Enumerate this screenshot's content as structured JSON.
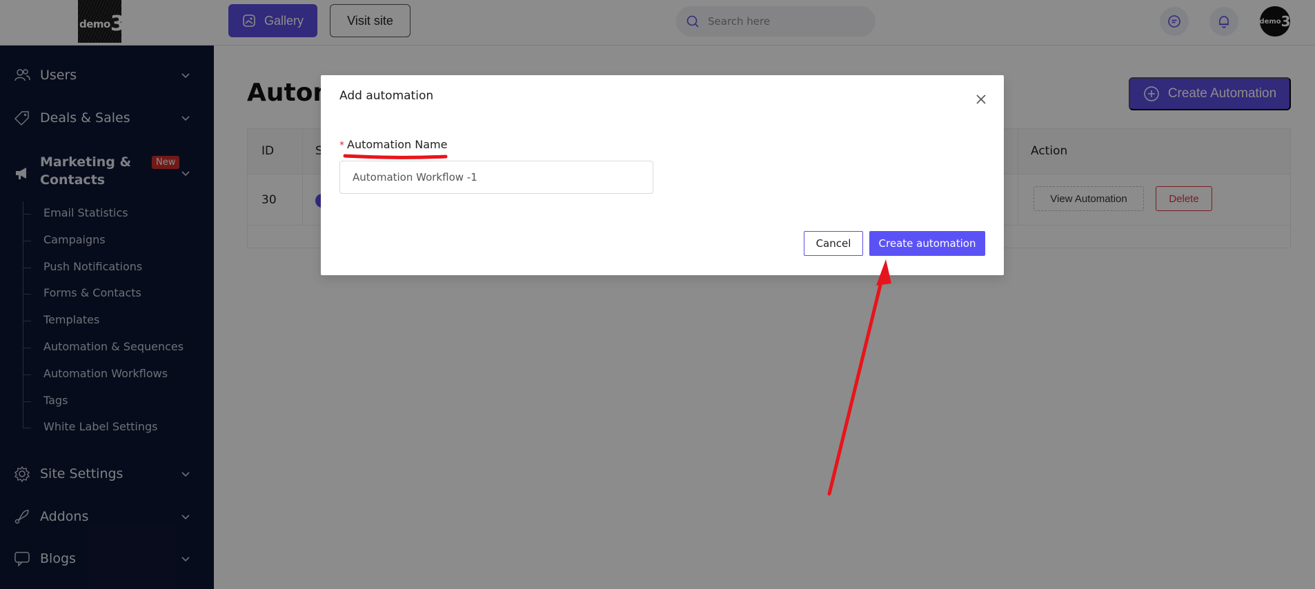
{
  "header": {
    "logo_text": "demo",
    "logo_number": "3",
    "gallery_label": "Gallery",
    "visit_site_label": "Visit site",
    "search_placeholder": "Search here",
    "chat_icon": "chat-icon",
    "bell_icon": "bell-icon"
  },
  "sidebar": {
    "items": [
      {
        "label": "Users",
        "icon": "users-icon"
      },
      {
        "label": "Deals & Sales",
        "icon": "tag-icon"
      },
      {
        "label": "Marketing &",
        "label2": "Contacts",
        "icon": "megaphone-icon",
        "badge": "New"
      },
      {
        "label": "Site Settings",
        "icon": "gear-icon"
      },
      {
        "label": "Addons",
        "icon": "rocket-icon"
      },
      {
        "label": "Blogs",
        "icon": "chat-bubble-icon"
      }
    ],
    "sub_items": [
      "Email Statistics",
      "Campaigns",
      "Push Notifications",
      "Forms & Contacts",
      "Templates",
      "Automation & Sequences",
      "Automation Workflows",
      "Tags",
      "White Label Settings"
    ]
  },
  "main": {
    "title": "Autom",
    "create_button": "Create Automation",
    "table": {
      "headers": [
        "ID",
        "S",
        "Action"
      ],
      "rows": [
        {
          "id": "30",
          "view_label": "View Automation",
          "delete_label": "Delete"
        }
      ]
    }
  },
  "modal": {
    "title": "Add automation",
    "field_label": "Automation Name",
    "required_mark": "*",
    "field_value": "Automation Workflow -1",
    "cancel_label": "Cancel",
    "create_label": "Create automation"
  },
  "colors": {
    "accent": "#5b4de0",
    "sidebar_bg": "#0e1633",
    "danger": "#d9363e",
    "annotation": "#e8141b"
  }
}
